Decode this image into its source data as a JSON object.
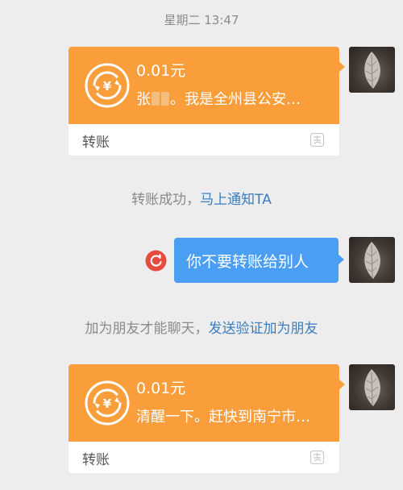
{
  "timestamp": "星期二 13:47",
  "transfers": [
    {
      "amount": "0.01元",
      "note_prefix": "张",
      "note_suffix": "。我是全州县公安…",
      "footer_label": "转账"
    },
    {
      "amount": "0.01元",
      "note_prefix": "清醒一下。赶快到南宁市…",
      "note_suffix": "",
      "footer_label": "转账"
    }
  ],
  "system_messages": [
    {
      "text": "转账成功，",
      "link": "马上通知TA"
    },
    {
      "text": "加为朋友才能聊天，",
      "link": "发送验证加为朋友"
    }
  ],
  "outgoing_message": {
    "text": "你不要转账给别人",
    "status": "failed-resend"
  },
  "colors": {
    "background": "#ededed",
    "transfer_orange": "#fa9d3b",
    "bubble_blue": "#4a9ff5",
    "link_blue": "#3a7ebf",
    "resend_red": "#e84a3f"
  },
  "icons": {
    "transfer": "yuan-exchange-icon",
    "payment_logo": "payment-logo-icon",
    "resend": "resend-icon"
  }
}
